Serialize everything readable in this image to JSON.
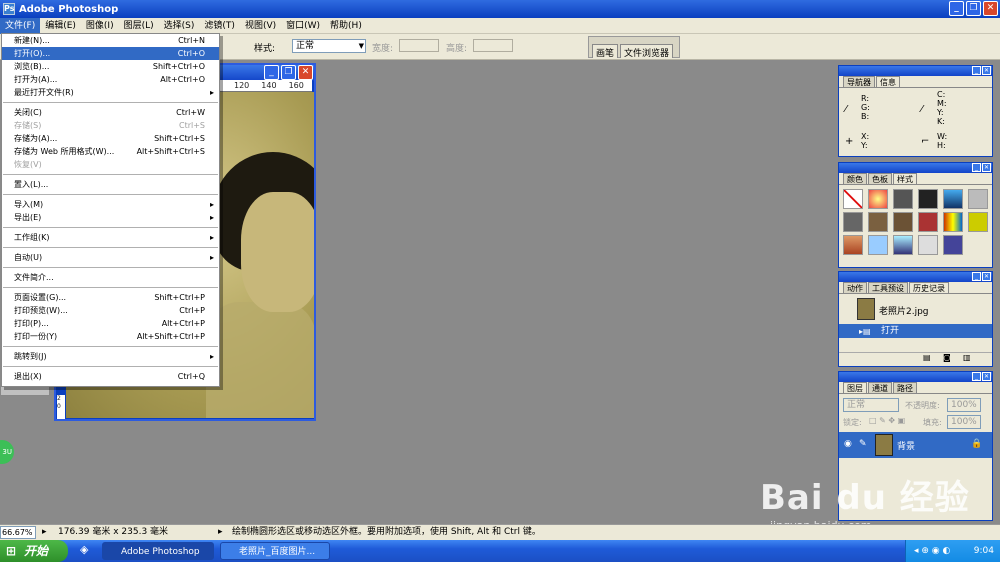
{
  "app": {
    "title": "Adobe Photoshop"
  },
  "menubar": {
    "items": [
      "文件(F)",
      "编辑(E)",
      "图像(I)",
      "图层(L)",
      "选择(S)",
      "滤镜(T)",
      "视图(V)",
      "窗口(W)",
      "帮助(H)"
    ]
  },
  "options": {
    "style_label": "样式:",
    "style_value": "正常",
    "width_label": "宽度:",
    "height_label": "高度:",
    "tab_brush": "画笔",
    "tab_browser": "文件浏览器"
  },
  "ruler": {
    "ticks": [
      "120",
      "140",
      "160"
    ]
  },
  "vruler": {
    "label": "2 0"
  },
  "file_menu": {
    "items": [
      {
        "label": "新建(N)...",
        "shortcut": "Ctrl+N",
        "state": "normal"
      },
      {
        "label": "打开(O)...",
        "shortcut": "Ctrl+O",
        "state": "selected"
      },
      {
        "label": "浏览(B)...",
        "shortcut": "Shift+Ctrl+O",
        "state": "normal"
      },
      {
        "label": "打开为(A)...",
        "shortcut": "Alt+Ctrl+O",
        "state": "normal"
      },
      {
        "label": "最近打开文件(R)",
        "shortcut": "",
        "state": "submenu"
      },
      {
        "sep": true
      },
      {
        "label": "关闭(C)",
        "shortcut": "Ctrl+W",
        "state": "normal"
      },
      {
        "label": "存储(S)",
        "shortcut": "Ctrl+S",
        "state": "disabled"
      },
      {
        "label": "存储为(A)...",
        "shortcut": "Shift+Ctrl+S",
        "state": "normal"
      },
      {
        "label": "存储为 Web 所用格式(W)...",
        "shortcut": "Alt+Shift+Ctrl+S",
        "state": "normal"
      },
      {
        "label": "恢复(V)",
        "shortcut": "",
        "state": "disabled"
      },
      {
        "sep": true
      },
      {
        "label": "置入(L)...",
        "shortcut": "",
        "state": "normal"
      },
      {
        "sep": true
      },
      {
        "label": "导入(M)",
        "shortcut": "",
        "state": "submenu"
      },
      {
        "label": "导出(E)",
        "shortcut": "",
        "state": "submenu"
      },
      {
        "sep": true
      },
      {
        "label": "工作组(K)",
        "shortcut": "",
        "state": "submenu"
      },
      {
        "sep": true
      },
      {
        "label": "自动(U)",
        "shortcut": "",
        "state": "submenu"
      },
      {
        "sep": true
      },
      {
        "label": "文件简介...",
        "shortcut": "",
        "state": "normal"
      },
      {
        "sep": true
      },
      {
        "label": "页面设置(G)...",
        "shortcut": "Shift+Ctrl+P",
        "state": "normal"
      },
      {
        "label": "打印预览(W)...",
        "shortcut": "Ctrl+P",
        "state": "normal"
      },
      {
        "label": "打印(P)...",
        "shortcut": "Alt+Ctrl+P",
        "state": "normal"
      },
      {
        "label": "打印一份(Y)",
        "shortcut": "Alt+Shift+Ctrl+P",
        "state": "normal"
      },
      {
        "sep": true
      },
      {
        "label": "跳转到(J)",
        "shortcut": "",
        "state": "submenu"
      },
      {
        "sep": true
      },
      {
        "label": "退出(X)",
        "shortcut": "Ctrl+Q",
        "state": "normal"
      }
    ]
  },
  "panels": {
    "navigator": {
      "tabs": [
        "导航器",
        "信息"
      ],
      "rgb": "R:\nG:\nB:",
      "cmyk": "C:\nM:\nY:\nK:",
      "xy": "X:\nY:",
      "wh": "W:\nH:"
    },
    "colors": {
      "tabs": [
        "颜色",
        "色板",
        "样式"
      ]
    },
    "history": {
      "tabs": [
        "动作",
        "工具预设",
        "历史记录"
      ],
      "snapshot": "老照片2.jpg",
      "step": "打开"
    },
    "layers": {
      "tabs": [
        "图层",
        "通道",
        "路径"
      ],
      "mode": "正常",
      "opacity_label": "不透明度:",
      "opacity": "100%",
      "lock_label": "锁定:",
      "fill_label": "填充:",
      "fill": "100%",
      "layer_name": "背景"
    }
  },
  "status": {
    "zoom": "66.67%",
    "size": "176.39 毫米 x 235.3 毫米",
    "hint": "绘制椭圆形选区或移动选区外框。要用附加选项，使用 Shift, Alt 和 Ctrl 键。"
  },
  "taskbar": {
    "start": "开始",
    "tasks": [
      "Adobe Photoshop",
      "老照片_百度图片..."
    ],
    "clock": "9:04"
  },
  "watermark": {
    "brand": "Bai du 经验",
    "url": "jingyan.baidu.com"
  },
  "badge": "3U"
}
